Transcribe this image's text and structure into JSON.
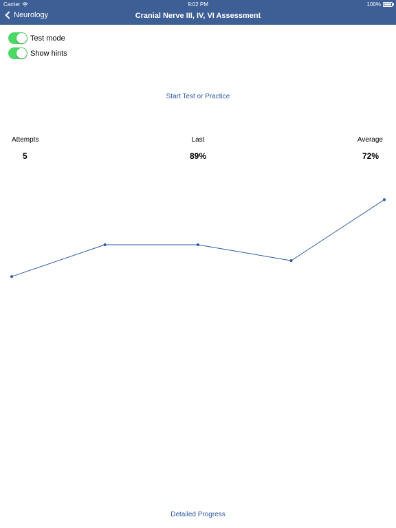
{
  "status_bar": {
    "carrier": "Carrier",
    "time": "9:02 PM",
    "battery": "100%",
    "battery_level": 1.0
  },
  "nav": {
    "back_label": "Neurology",
    "title": "Cranial Nerve III, IV, VI Assessment"
  },
  "toggles": [
    {
      "label": "Test mode",
      "on": true
    },
    {
      "label": "Show hints",
      "on": true
    }
  ],
  "start_link": "Start Test or Practice",
  "stats": {
    "attempts_label": "Attempts",
    "attempts_value": "5",
    "last_label": "Last",
    "last_value": "89%",
    "average_label": "Average",
    "average_value": "72%"
  },
  "chart_data": {
    "type": "line",
    "x": [
      1,
      2,
      3,
      4,
      5
    ],
    "series": [
      {
        "values": [
          60,
          72,
          72,
          66,
          89
        ]
      }
    ],
    "ylim": [
      30,
      100
    ],
    "grid": false,
    "line_color": "#2d57a0"
  },
  "detail_link": "Detailed Progress",
  "colors": {
    "nav_bg": "#3d5f96",
    "accent": "#2d57a0",
    "switch_on": "#4cd964"
  }
}
